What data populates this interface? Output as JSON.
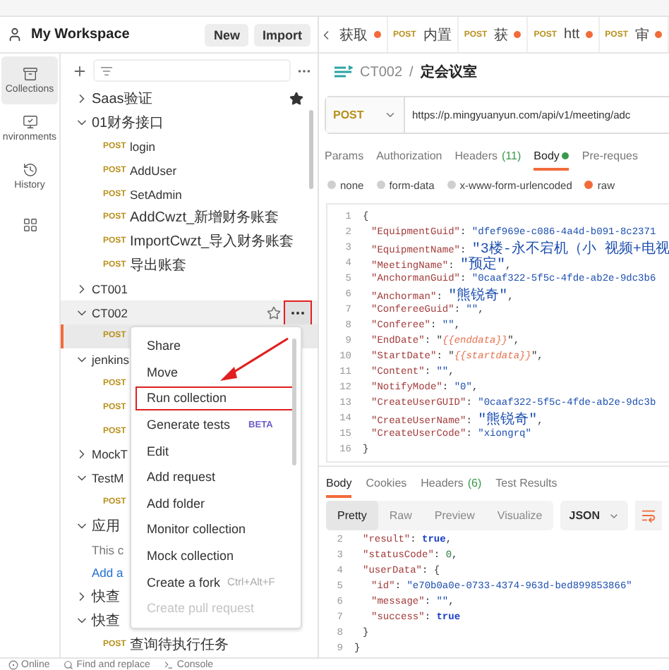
{
  "workspace": {
    "name": "My Workspace",
    "buttons": [
      "New",
      "Import"
    ]
  },
  "rail": [
    {
      "kind": "collections",
      "label": "Collections",
      "selected": true
    },
    {
      "kind": "environments",
      "label": "nvironments",
      "selected": false
    },
    {
      "kind": "history",
      "label": "History",
      "selected": false
    },
    {
      "kind": "apps",
      "selected": false
    }
  ],
  "tree": [
    {
      "kind": "folder",
      "name": "Saas验证",
      "expanded": false,
      "starred": true
    },
    {
      "kind": "folder",
      "name": "01财务接口",
      "expanded": true,
      "children": [
        {
          "kind": "request",
          "method": "POST",
          "name": "login",
          "selected": false
        },
        {
          "kind": "request",
          "method": "POST",
          "name": "AddUser",
          "selected": false
        },
        {
          "kind": "request",
          "method": "POST",
          "name": "SetAdmin",
          "selected": false
        },
        {
          "kind": "request",
          "method": "POST",
          "name": "AddCwzt_新增财务账套",
          "selected": false
        },
        {
          "kind": "request",
          "method": "POST",
          "name": "ImportCwzt_导入财务账套",
          "selected": false
        },
        {
          "kind": "request",
          "method": "POST",
          "name": "导出账套",
          "selected": false
        }
      ]
    },
    {
      "kind": "folder",
      "name": "CT001",
      "expanded": false
    },
    {
      "kind": "folder",
      "name": "CT002",
      "expanded": true,
      "hovered": true,
      "menu_open": true,
      "children": [
        {
          "kind": "request",
          "method": "POST",
          "selected": true
        }
      ]
    },
    {
      "kind": "folder",
      "name": "jenkins",
      "expanded": true,
      "children": [
        {
          "kind": "request",
          "method": "POST",
          "selected": false
        },
        {
          "kind": "request",
          "method": "POST",
          "selected": false
        },
        {
          "kind": "request",
          "method": "POST",
          "selected": false
        }
      ]
    },
    {
      "kind": "folder",
      "name": "MockT",
      "expanded": false
    },
    {
      "kind": "folder",
      "name": "TestM",
      "expanded": true,
      "children": [
        {
          "kind": "request",
          "method": "POST",
          "selected": false
        }
      ]
    },
    {
      "kind": "folder",
      "name": "应用",
      "expanded": true,
      "children": [
        {
          "kind": "note",
          "text": "This c"
        },
        {
          "kind": "link",
          "text": "Add a"
        }
      ]
    },
    {
      "kind": "folder",
      "name": "快查",
      "expanded": false
    },
    {
      "kind": "folder",
      "name": "快查",
      "expanded": true,
      "children": [
        {
          "kind": "request",
          "method": "POST",
          "name": "查询待执行任务",
          "selected": false
        }
      ]
    }
  ],
  "context_menu": {
    "items": [
      {
        "label": "Share",
        "highlighted": false,
        "disabled": false
      },
      {
        "label": "Move",
        "highlighted": false,
        "disabled": false
      },
      {
        "label": "Run collection",
        "highlighted": true,
        "disabled": false
      },
      {
        "label": "Generate tests",
        "badge": "BETA",
        "highlighted": false,
        "disabled": false
      },
      {
        "label": "Edit",
        "highlighted": false,
        "disabled": false
      },
      {
        "label": "Add request",
        "highlighted": false,
        "disabled": false
      },
      {
        "label": "Add folder",
        "highlighted": false,
        "disabled": false
      },
      {
        "label": "Monitor collection",
        "highlighted": false,
        "disabled": false
      },
      {
        "label": "Mock collection",
        "highlighted": false,
        "disabled": false
      },
      {
        "label": "Create a fork",
        "shortcut": "Ctrl+Alt+F",
        "highlighted": false,
        "disabled": false
      },
      {
        "label": "Create pull request",
        "highlighted": false,
        "disabled": true
      }
    ]
  },
  "annotation": {
    "arrow": true
  },
  "request_tabs": [
    {
      "label": "获取",
      "unsaved": true
    },
    {
      "method": "POST",
      "label": "内置",
      "unsaved": false
    },
    {
      "method": "POST",
      "label": "获",
      "unsaved": true
    },
    {
      "method": "POST",
      "label": "htt",
      "unsaved": true
    },
    {
      "method": "POST",
      "label": "审",
      "unsaved": true
    }
  ],
  "breadcrumb": {
    "collection": "CT002",
    "separator": "/",
    "request": "定会议室"
  },
  "request": {
    "method": "POST",
    "url": "https://p.mingyuanyun.com/api/v1/meeting/adc"
  },
  "request_sections": [
    {
      "label": "Params",
      "selected": false
    },
    {
      "label": "Authorization",
      "selected": false
    },
    {
      "label": "Headers",
      "count": "(11)",
      "selected": false
    },
    {
      "label": "Body",
      "selected": true,
      "modified": true
    },
    {
      "label": "Pre-reques",
      "selected": false
    }
  ],
  "body_modes": [
    {
      "label": "none",
      "selected": false
    },
    {
      "label": "form-data",
      "selected": false
    },
    {
      "label": "x-www-form-urlencoded",
      "selected": false
    },
    {
      "label": "raw",
      "selected": true
    }
  ],
  "body_code": [
    {
      "number": "1",
      "tokens": [
        {
          "kind": "punct",
          "text": "{"
        }
      ],
      "children": [
        {
          "number": "2",
          "tokens": [
            {
              "kind": "key",
              "text": "\"EquipmentGuid\""
            },
            {
              "kind": "punct",
              "text": ": "
            },
            {
              "kind": "string",
              "text": "\"dfef969e-c086-4a4d-b091-8c2371"
            }
          ]
        },
        {
          "number": "3",
          "tokens": [
            {
              "kind": "key",
              "text": "\"EquipmentName\""
            },
            {
              "kind": "punct",
              "text": ": "
            },
            {
              "kind": "string",
              "text": "\"3楼-永不宕机（小 视频+电视"
            }
          ]
        },
        {
          "number": "4",
          "tokens": [
            {
              "kind": "key",
              "text": "\"MeetingName\""
            },
            {
              "kind": "punct",
              "text": ": "
            },
            {
              "kind": "string",
              "text": "\"预定\""
            },
            {
              "kind": "punct",
              "text": ","
            }
          ]
        },
        {
          "number": "5",
          "tokens": [
            {
              "kind": "key",
              "text": "\"AnchormanGuid\""
            },
            {
              "kind": "punct",
              "text": ": "
            },
            {
              "kind": "string",
              "text": "\"0caaf322-5f5c-4fde-ab2e-9dc3b6"
            }
          ]
        },
        {
          "number": "6",
          "tokens": [
            {
              "kind": "key",
              "text": "\"Anchorman\""
            },
            {
              "kind": "punct",
              "text": ": "
            },
            {
              "kind": "string",
              "text": "\"熊锐奇\""
            },
            {
              "kind": "punct",
              "text": ","
            }
          ]
        },
        {
          "number": "7",
          "tokens": [
            {
              "kind": "key",
              "text": "\"ConfereeGuid\""
            },
            {
              "kind": "punct",
              "text": ": "
            },
            {
              "kind": "string",
              "text": "\"\""
            },
            {
              "kind": "punct",
              "text": ","
            }
          ]
        },
        {
          "number": "8",
          "tokens": [
            {
              "kind": "key",
              "text": "\"Conferee\""
            },
            {
              "kind": "punct",
              "text": ": "
            },
            {
              "kind": "string",
              "text": "\"\""
            },
            {
              "kind": "punct",
              "text": ","
            }
          ]
        },
        {
          "number": "9",
          "tokens": [
            {
              "kind": "key",
              "text": "\"EndDate\""
            },
            {
              "kind": "punct",
              "text": ": \""
            },
            {
              "kind": "var",
              "text": "{{enddata}}"
            },
            {
              "kind": "punct",
              "text": "\","
            }
          ]
        },
        {
          "number": "10",
          "tokens": [
            {
              "kind": "key",
              "text": "\"StartDate\""
            },
            {
              "kind": "punct",
              "text": ": \""
            },
            {
              "kind": "var",
              "text": "{{startdata}}"
            },
            {
              "kind": "punct",
              "text": "\","
            }
          ]
        },
        {
          "number": "11",
          "tokens": [
            {
              "kind": "key",
              "text": "\"Content\""
            },
            {
              "kind": "punct",
              "text": ": "
            },
            {
              "kind": "string",
              "text": "\"\""
            },
            {
              "kind": "punct",
              "text": ","
            }
          ]
        },
        {
          "number": "12",
          "tokens": [
            {
              "kind": "key",
              "text": "\"NotifyMode\""
            },
            {
              "kind": "punct",
              "text": ": "
            },
            {
              "kind": "string",
              "text": "\"0\""
            },
            {
              "kind": "punct",
              "text": ","
            }
          ]
        },
        {
          "number": "13",
          "tokens": [
            {
              "kind": "key",
              "text": "\"CreateUserGUID\""
            },
            {
              "kind": "punct",
              "text": ": "
            },
            {
              "kind": "string",
              "text": "\"0caaf322-5f5c-4fde-ab2e-9dc3b"
            }
          ]
        },
        {
          "number": "14",
          "tokens": [
            {
              "kind": "key",
              "text": "\"CreateUserName\""
            },
            {
              "kind": "punct",
              "text": ": "
            },
            {
              "kind": "string",
              "text": "\"熊锐奇\""
            },
            {
              "kind": "punct",
              "text": ","
            }
          ]
        },
        {
          "number": "15",
          "tokens": [
            {
              "kind": "key",
              "text": "\"CreateUserCode\""
            },
            {
              "kind": "punct",
              "text": ": "
            },
            {
              "kind": "string",
              "text": "\"xiongrq\""
            }
          ]
        }
      ]
    },
    {
      "number": "16",
      "tokens": [
        {
          "kind": "punct",
          "text": "}"
        }
      ]
    }
  ],
  "response": {
    "tabs": [
      {
        "label": "Body",
        "selected": true
      },
      {
        "label": "Cookies",
        "selected": false
      },
      {
        "label": "Headers",
        "count": "(6)",
        "selected": false
      },
      {
        "label": "Test Results",
        "selected": false
      }
    ],
    "views": [
      {
        "label": "Pretty",
        "selected": true
      },
      {
        "label": "Raw",
        "selected": false
      },
      {
        "label": "Preview",
        "selected": false
      },
      {
        "label": "Visualize",
        "selected": false
      }
    ],
    "format": "JSON",
    "code": [
      {
        "children": [
          {
            "number": "2",
            "tokens": [
              {
                "kind": "key",
                "text": "\"result\""
              },
              {
                "kind": "punct",
                "text": ": "
              },
              {
                "kind": "literal",
                "text": "true"
              },
              {
                "kind": "punct",
                "text": ","
              }
            ]
          },
          {
            "number": "3",
            "tokens": [
              {
                "kind": "key",
                "text": "\"statusCode\""
              },
              {
                "kind": "punct",
                "text": ": "
              },
              {
                "kind": "number",
                "text": "0"
              },
              {
                "kind": "punct",
                "text": ","
              }
            ]
          },
          {
            "number": "4",
            "tokens": [
              {
                "kind": "key",
                "text": "\"userData\""
              },
              {
                "kind": "punct",
                "text": ": {"
              }
            ],
            "children": [
              {
                "number": "5",
                "tokens": [
                  {
                    "kind": "key",
                    "text": "\"id\""
                  },
                  {
                    "kind": "punct",
                    "text": ": "
                  },
                  {
                    "kind": "string",
                    "text": "\"e70b0a0e-0733-4374-963d-bed899853866\""
                  }
                ]
              },
              {
                "number": "6",
                "tokens": [
                  {
                    "kind": "key",
                    "text": "\"message\""
                  },
                  {
                    "kind": "punct",
                    "text": ": "
                  },
                  {
                    "kind": "string",
                    "text": "\"\""
                  },
                  {
                    "kind": "punct",
                    "text": ","
                  }
                ]
              },
              {
                "number": "7",
                "tokens": [
                  {
                    "kind": "key",
                    "text": "\"success\""
                  },
                  {
                    "kind": "punct",
                    "text": ": "
                  },
                  {
                    "kind": "literal",
                    "text": "true"
                  }
                ]
              }
            ]
          },
          {
            "number": "8",
            "tokens": [
              {
                "kind": "punct",
                "text": "}"
              }
            ]
          }
        ]
      },
      {
        "number": "9",
        "tokens": [
          {
            "kind": "punct",
            "text": "}"
          }
        ]
      }
    ]
  },
  "status_bar": [
    "Online",
    "Find and replace",
    "Console"
  ]
}
